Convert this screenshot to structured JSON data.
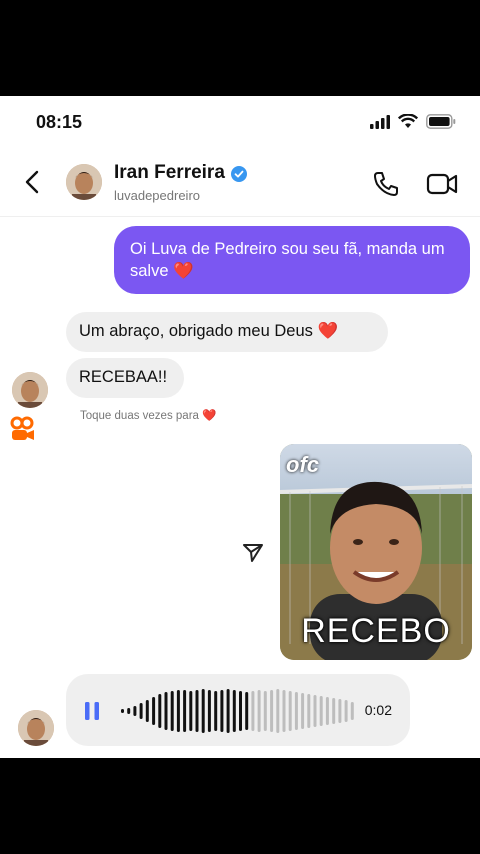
{
  "status_bar": {
    "time": "08:15"
  },
  "header": {
    "name": "Iran Ferreira",
    "username": "luvadepedreiro"
  },
  "messages": {
    "outgoing_1": "Oi Luva de Pedreiro sou seu fã, manda um salve",
    "incoming_1": "Um abraço, obrigado meu Deus",
    "incoming_2": "RECEBAA!!",
    "double_tap_hint": "Toque duas vezes para",
    "heart": "❤️"
  },
  "sticker": {
    "overlay_text": "ofc",
    "caption": "RECEBO"
  },
  "voice_message": {
    "duration": "0:02",
    "progress": 0.55
  },
  "colors": {
    "outgoing_bubble": "#7b57f2",
    "incoming_bubble": "#efefef",
    "heart": "#e32a2a",
    "verified": "#3897f0",
    "play": "#4a6cf7"
  }
}
